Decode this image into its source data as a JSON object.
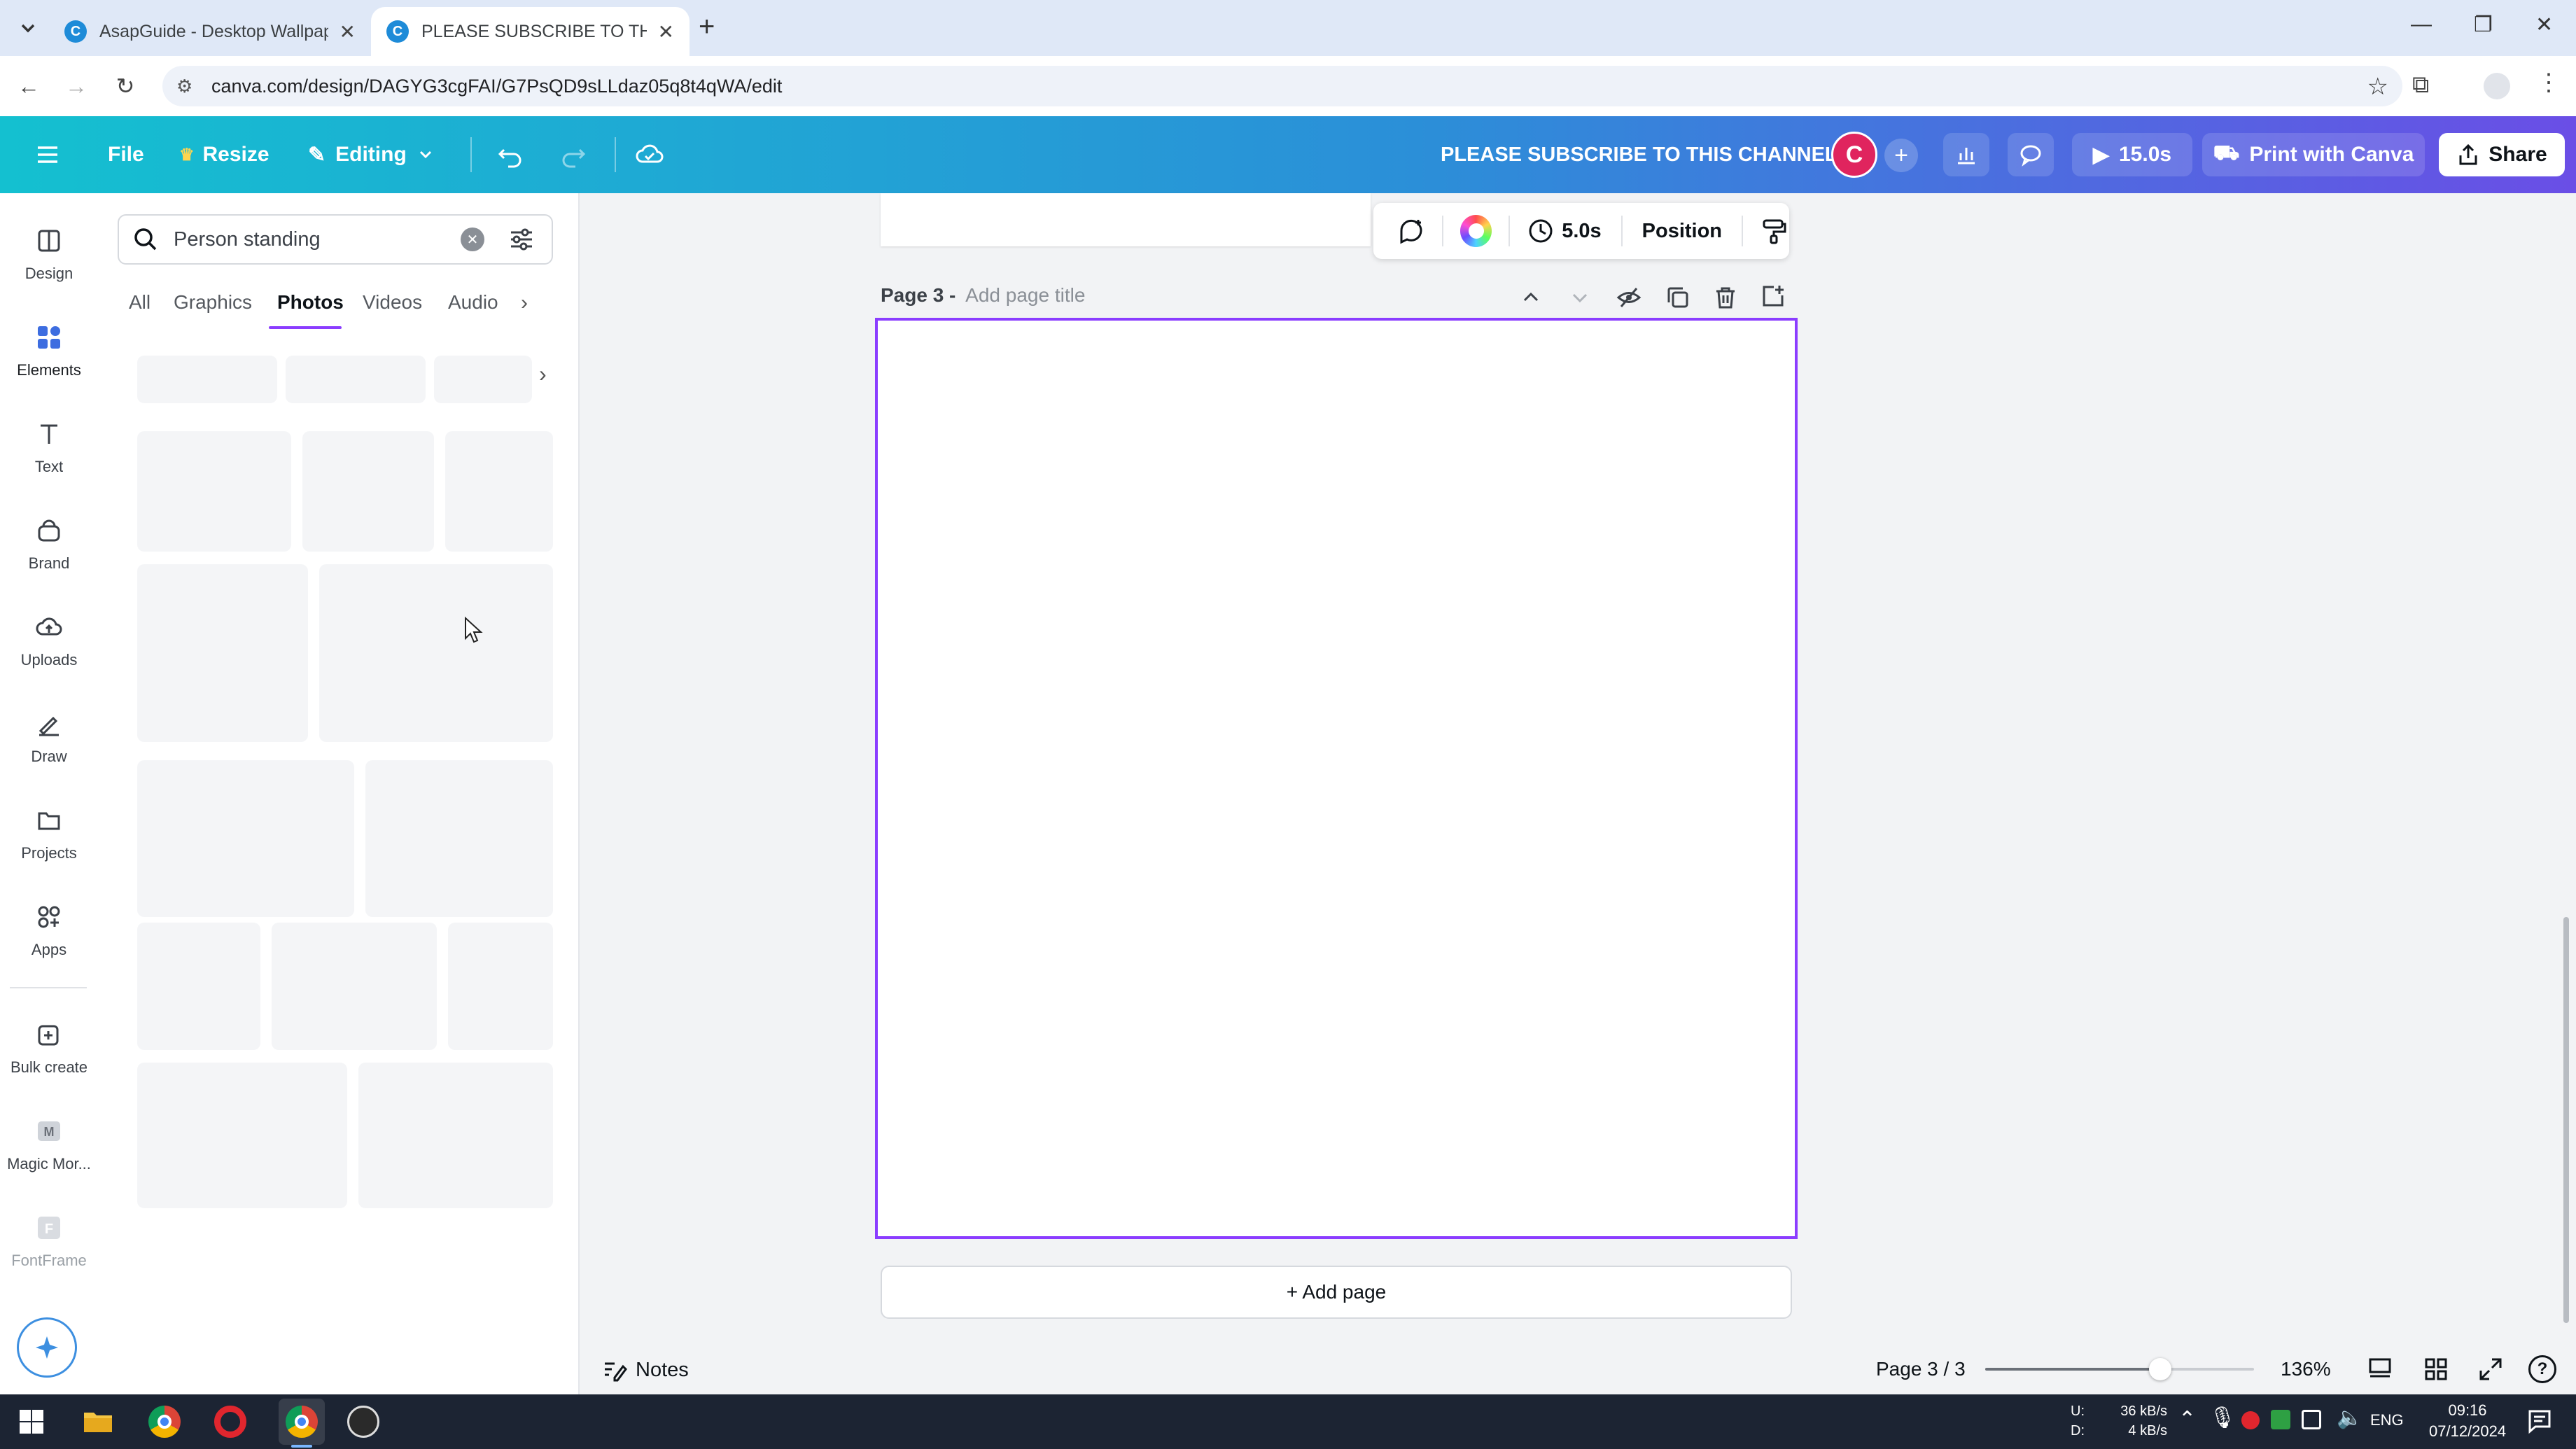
{
  "browser": {
    "tabs": [
      {
        "title": "AsapGuide - Desktop Wallpape",
        "active": false
      },
      {
        "title": "PLEASE SUBSCRIBE TO THIS CH",
        "active": true
      }
    ],
    "url": "canva.com/design/DAGYG3cgFAI/G7PsQD9sLLdaz05q8t4qWA/edit"
  },
  "topbar": {
    "file": "File",
    "resize": "Resize",
    "editing": "Editing",
    "design_title": "PLEASE SUBSCRIBE TO THIS CHANNEL",
    "avatar_letter": "C",
    "play_duration": "15.0s",
    "print": "Print with Canva",
    "share": "Share"
  },
  "rail": {
    "items": [
      {
        "label": "Design",
        "icon": "design-icon"
      },
      {
        "label": "Elements",
        "icon": "elements-icon"
      },
      {
        "label": "Text",
        "icon": "text-icon"
      },
      {
        "label": "Brand",
        "icon": "brand-icon"
      },
      {
        "label": "Uploads",
        "icon": "uploads-icon"
      },
      {
        "label": "Draw",
        "icon": "draw-icon"
      },
      {
        "label": "Projects",
        "icon": "projects-icon"
      },
      {
        "label": "Apps",
        "icon": "apps-icon"
      },
      {
        "label": "Bulk create",
        "icon": "bulk-create-icon"
      },
      {
        "label": "Magic Mor...",
        "icon": "magic-morph-icon"
      },
      {
        "label": "FontFrame",
        "icon": "fontframe-icon"
      }
    ]
  },
  "panel": {
    "search_value": "Person standing",
    "tabs": [
      "All",
      "Graphics",
      "Photos",
      "Videos",
      "Audio"
    ],
    "active_tab": "Photos"
  },
  "context_toolbar": {
    "duration": "5.0s",
    "position": "Position"
  },
  "page": {
    "label": "Page 3 -",
    "title_placeholder": "Add page title"
  },
  "add_page": "+ Add page",
  "bottom": {
    "notes": "Notes",
    "page_indicator": "Page 3 / 3",
    "zoom": "136%",
    "zoom_fraction": 0.65
  },
  "taskbar": {
    "net_up_label": "U:",
    "net_down_label": "D:",
    "net_up": "36 kB/s",
    "net_down": "4 kB/s",
    "lang": "ENG",
    "time": "09:16",
    "date": "07/12/2024"
  },
  "colors": {
    "accent": "#8b3dff",
    "avatar": "#e0245e"
  }
}
